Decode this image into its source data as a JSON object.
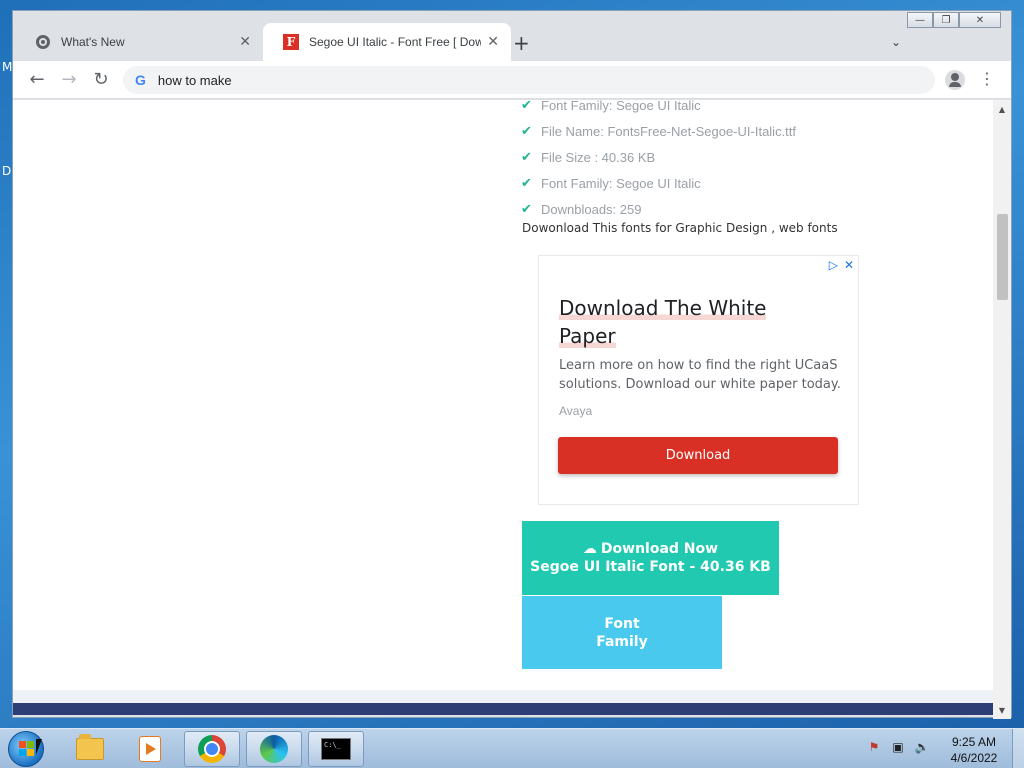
{
  "desktop": {
    "left_letters": [
      "M",
      "D"
    ]
  },
  "window_controls": {
    "minimize": "—",
    "restore": "❐",
    "close": "✕"
  },
  "tabs": [
    {
      "title": "What's New",
      "icon": "chrome-icon",
      "close": "✕"
    },
    {
      "title": "Segoe UI Italic - Font Free [ Dow",
      "icon": "fontsfree-favicon",
      "close": "✕",
      "favicon_letter": "F"
    }
  ],
  "new_tab": "+",
  "tab_search": "⌄",
  "toolbar": {
    "back": "←",
    "forward": "→",
    "reload": "↻",
    "omnibox_icon": "G",
    "omnibox_text": "how to make",
    "menu": "⋮"
  },
  "font_details": [
    {
      "check": "✔",
      "text": "Font Family: Segoe UI Italic"
    },
    {
      "check": "✔",
      "text": "File Name: FontsFree-Net-Segoe-UI-Italic.ttf"
    },
    {
      "check": "✔",
      "text": "File Size : 40.36 KB"
    },
    {
      "check": "✔",
      "text": "Font Family: Segoe UI Italic"
    },
    {
      "check": "✔",
      "text": "Downbloads: 259"
    }
  ],
  "intro_text": "Dowonload This fonts for Graphic Design , web fonts",
  "ad": {
    "icons": [
      "▷",
      "✕"
    ],
    "title_line1": "Download The White",
    "title_line2": "Paper",
    "description": "Learn more on how to find the right UCaaS solutions. Download our white paper today.",
    "advertiser": "Avaya",
    "button": "Download",
    "button_color": "#d93025"
  },
  "download_now": {
    "icon": "☁",
    "line1": "Download Now",
    "line2": "Segoe UI Italic Font - 40.36 KB",
    "color": "#20c9b0"
  },
  "font_family_button": {
    "line1": "Font",
    "line2": "Family",
    "color": "#4ac9ee"
  },
  "scrollbar": {
    "up": "▲",
    "down": "▼"
  },
  "taskbar": {
    "cmd_text": "C:\\_",
    "tray": {
      "flag": "⚑",
      "network": "▣",
      "volume": "🔈"
    },
    "time": "9:25 AM",
    "date": "4/6/2022"
  }
}
